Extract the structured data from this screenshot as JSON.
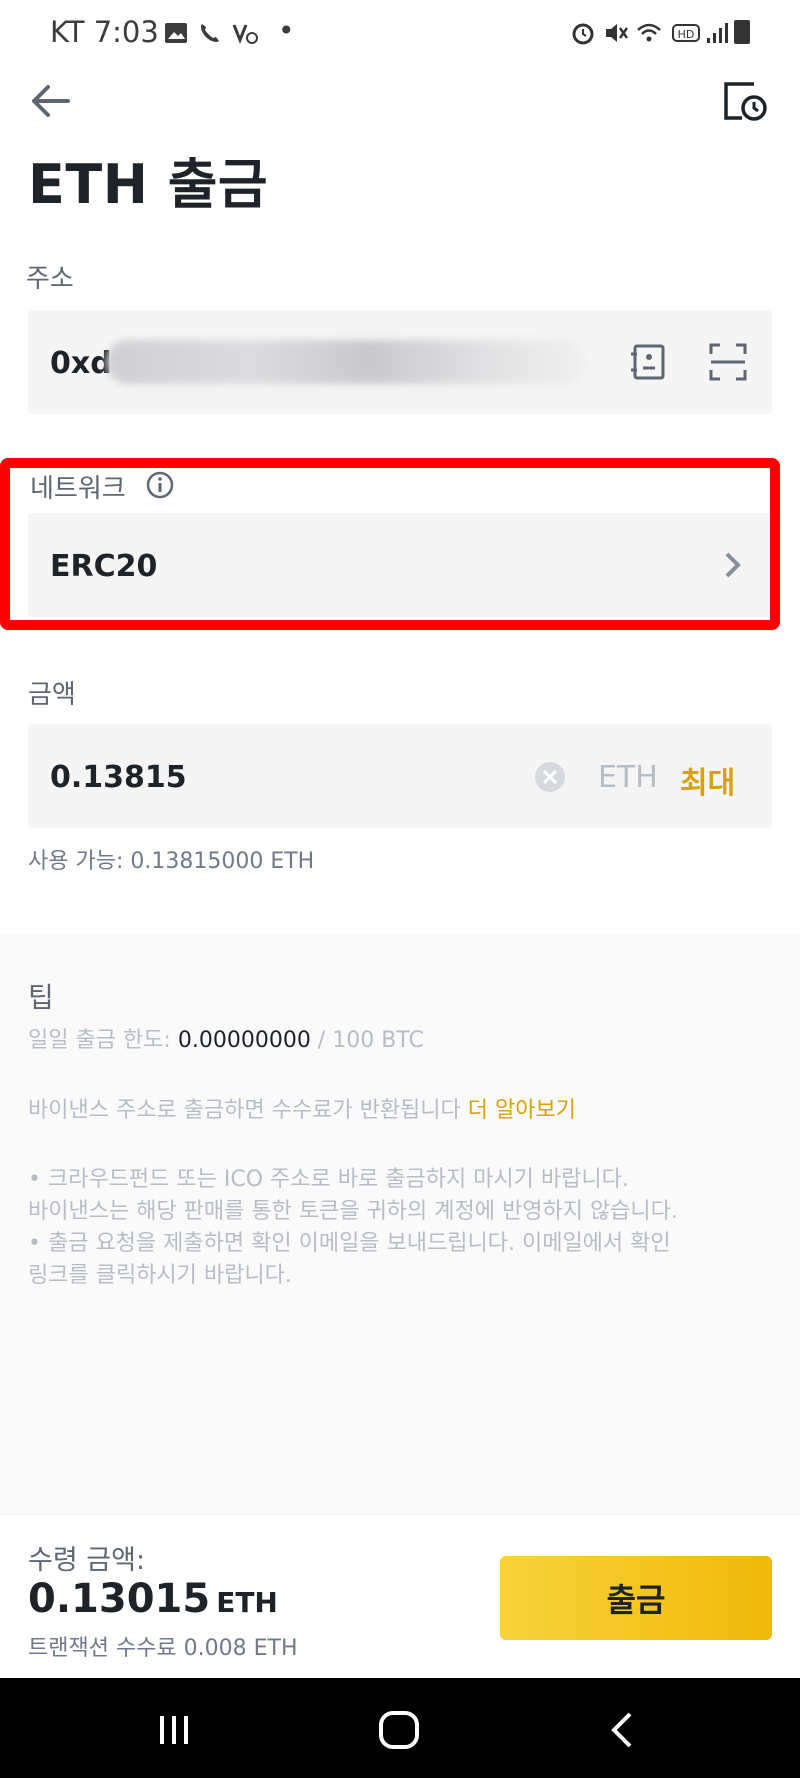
{
  "status_bar": {
    "carrier_time": "KT 7:03",
    "dot": "•",
    "left_icons": [
      "image-icon",
      "wifi-call-icon",
      "volte-icon"
    ],
    "right_icons": [
      "alarm-icon",
      "mute-icon",
      "wifi-icon",
      "hd-icon",
      "signal-icon",
      "battery-icon"
    ]
  },
  "header": {
    "title": "ETH 출금",
    "back_icon": "arrow-left-icon",
    "history_icon": "history-icon"
  },
  "address": {
    "label": "주소",
    "value_prefix": "0xd",
    "address_book_icon": "address-book-icon",
    "scan_icon": "scan-icon"
  },
  "network": {
    "label": "네트워크",
    "value": "ERC20",
    "info_icon": "info-icon"
  },
  "amount": {
    "label": "금액",
    "value": "0.13815",
    "unit": "ETH",
    "max_label": "최대",
    "available": "사용 가능: 0.13815000 ETH"
  },
  "tips": {
    "title": "팁",
    "daily_limit_prefix": "일일 출금 한도: ",
    "daily_limit_value": "0.00000000",
    "daily_limit_suffix": " / 100 BTC",
    "refund_text": "바이낸스 주소로 출금하면 수수료가 반환됩니다 ",
    "learn_more": "더 알아보기",
    "bullet1_line1": "• 크라우드펀드 또는 ICO 주소로 바로 출금하지 마시기 바랍니다.",
    "bullet1_line2": "바이낸스는 해당 판매를 통한 토큰을 귀하의 계정에 반영하지 않습니다.",
    "bullet2_line1": "• 출금 요청을 제출하면 확인 이메일을 보내드립니다. 이메일에서 확인",
    "bullet2_line2": "링크를 클릭하시기 바랍니다."
  },
  "bottom": {
    "receive_label": "수령 금액:",
    "receive_amount": "0.13015",
    "receive_unit": "ETH",
    "fee": "트랜잭션 수수료 0.008 ETH",
    "withdraw_button": "출금"
  },
  "colors": {
    "accent": "#f0b90b",
    "highlight": "#ff0000",
    "link": "#d8a20c",
    "field_bg": "#f5f5f5"
  }
}
